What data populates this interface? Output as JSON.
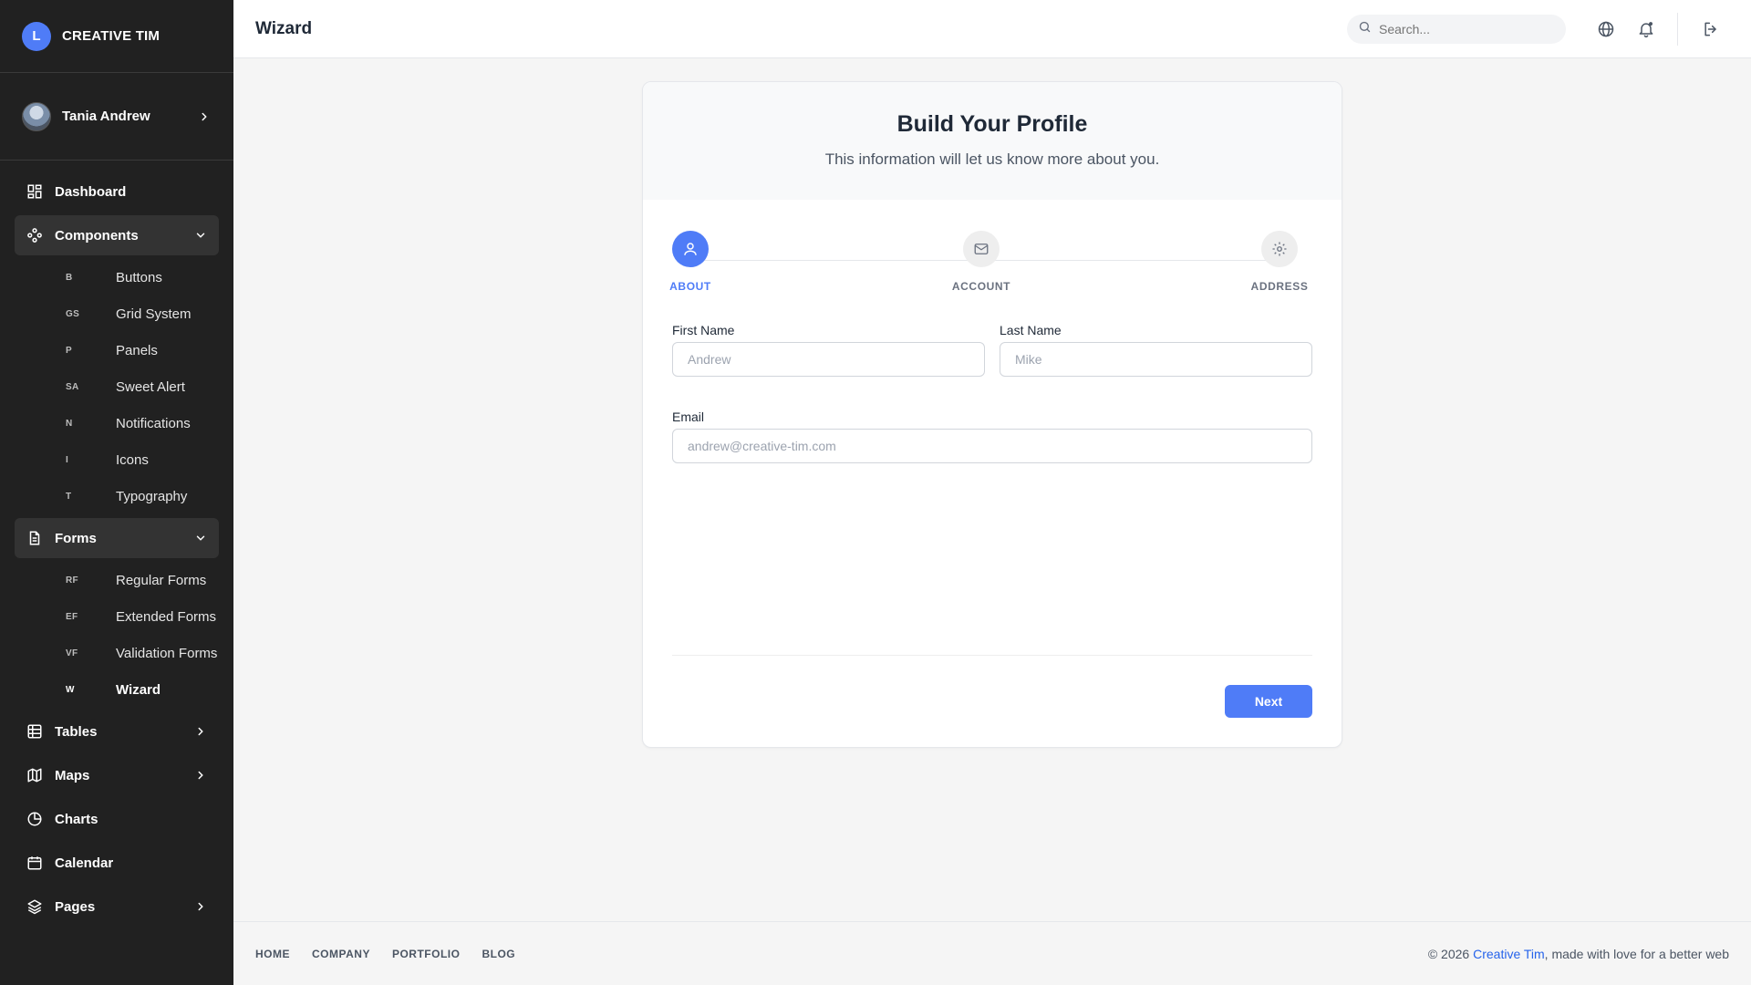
{
  "brand": {
    "logo_letter": "L",
    "name": "CREATIVE TIM"
  },
  "user": {
    "name": "Tania Andrew"
  },
  "nav": {
    "dashboard": "Dashboard",
    "components": {
      "label": "Components",
      "items": [
        {
          "abbr": "B",
          "label": "Buttons"
        },
        {
          "abbr": "GS",
          "label": "Grid System"
        },
        {
          "abbr": "P",
          "label": "Panels"
        },
        {
          "abbr": "SA",
          "label": "Sweet Alert"
        },
        {
          "abbr": "N",
          "label": "Notifications"
        },
        {
          "abbr": "I",
          "label": "Icons"
        },
        {
          "abbr": "T",
          "label": "Typography"
        }
      ]
    },
    "forms": {
      "label": "Forms",
      "items": [
        {
          "abbr": "RF",
          "label": "Regular Forms"
        },
        {
          "abbr": "EF",
          "label": "Extended Forms"
        },
        {
          "abbr": "VF",
          "label": "Validation Forms"
        },
        {
          "abbr": "W",
          "label": "Wizard"
        }
      ]
    },
    "tables": "Tables",
    "maps": "Maps",
    "charts": "Charts",
    "calendar": "Calendar",
    "pages": "Pages"
  },
  "header": {
    "title": "Wizard",
    "search_placeholder": "Search..."
  },
  "wizard": {
    "title": "Build Your Profile",
    "subtitle": "This information will let us know more about you.",
    "steps": [
      {
        "label": "ABOUT",
        "icon": "user-icon",
        "active": true
      },
      {
        "label": "ACCOUNT",
        "icon": "mail-icon",
        "active": false
      },
      {
        "label": "ADDRESS",
        "icon": "gear-icon",
        "active": false
      }
    ],
    "fields": {
      "first_name": {
        "label": "First Name",
        "placeholder": "Andrew"
      },
      "last_name": {
        "label": "Last Name",
        "placeholder": "Mike"
      },
      "email": {
        "label": "Email",
        "placeholder": "andrew@creative-tim.com"
      }
    },
    "next_label": "Next"
  },
  "footer": {
    "links": [
      "HOME",
      "COMPANY",
      "PORTFOLIO",
      "BLOG"
    ],
    "copyright_prefix": "© 2026 ",
    "copyright_brand": "Creative Tim",
    "copyright_suffix": ", made with love for a better web"
  },
  "colors": {
    "accent": "#4f7cf7",
    "sidebar_bg": "#212121",
    "link": "#2563eb"
  }
}
